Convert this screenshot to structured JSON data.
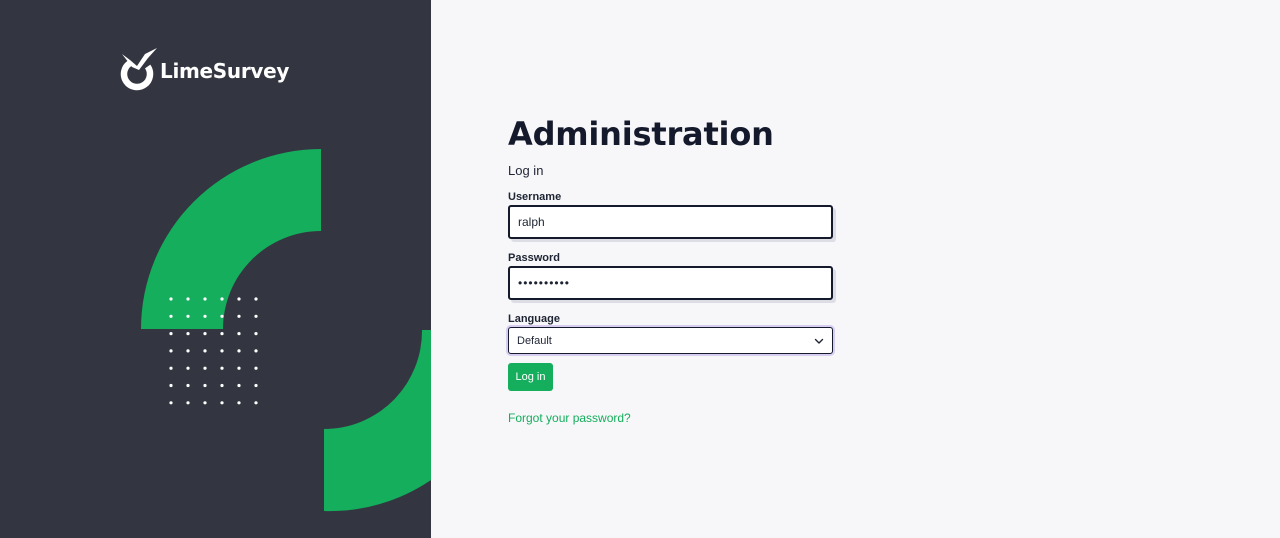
{
  "brand": {
    "name": "LimeSurvey",
    "logo_icon": "limesurvey-logo-icon"
  },
  "colors": {
    "sidebar_bg": "#333641",
    "accent_green": "#14ae5c",
    "page_bg": "#f7f7f9",
    "text_dark": "#14192b"
  },
  "login": {
    "title": "Administration",
    "subtitle": "Log in",
    "username": {
      "label": "Username",
      "value": "ralph"
    },
    "password": {
      "label": "Password",
      "value": "••••••••••"
    },
    "language": {
      "label": "Language",
      "selected": "Default",
      "icon": "chevron-down-icon"
    },
    "submit_label": "Log in",
    "forgot_link": "Forgot your password?"
  }
}
